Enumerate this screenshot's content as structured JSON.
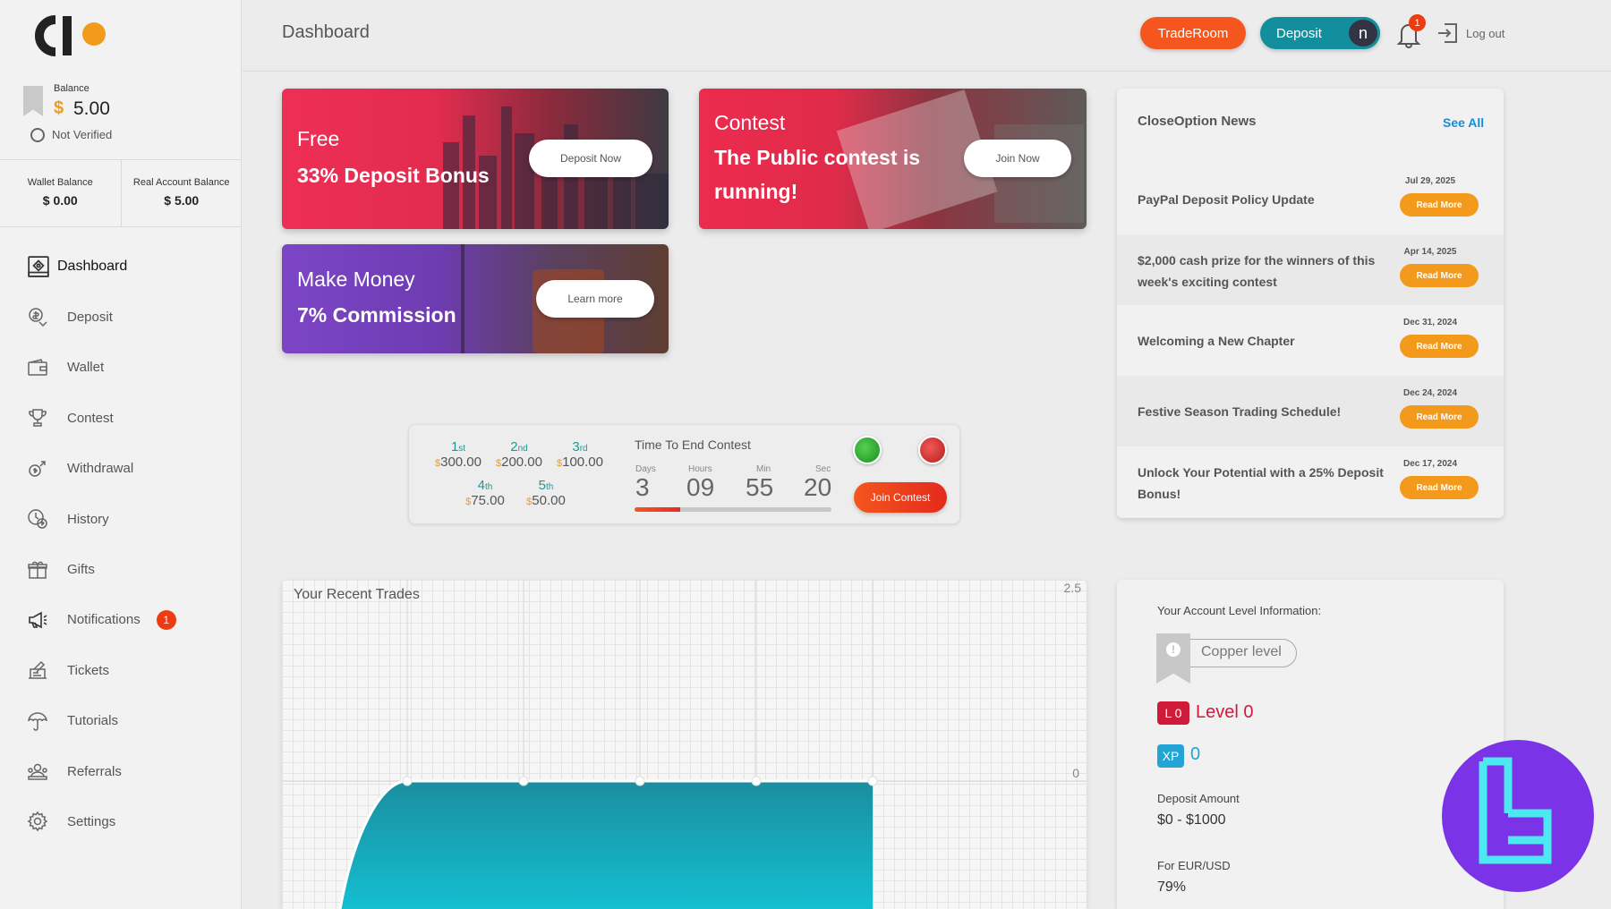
{
  "brand": {
    "accent": "#f39a1d",
    "orange": "#f4561e",
    "teal": "#128e9d"
  },
  "sidebar": {
    "balance_label": "Balance",
    "balance_currency": "$",
    "balance_value": "5.00",
    "verification": "Not Verified",
    "wallet_balance_label": "Wallet Balance",
    "wallet_balance_value": "$ 0.00",
    "real_balance_label": "Real Account Balance",
    "real_balance_value": "$ 5.00",
    "items": [
      {
        "label": "Dashboard",
        "icon": "dashboard-icon"
      },
      {
        "label": "Deposit",
        "icon": "deposit-icon"
      },
      {
        "label": "Wallet",
        "icon": "wallet-icon"
      },
      {
        "label": "Contest",
        "icon": "trophy-icon"
      },
      {
        "label": "Withdrawal",
        "icon": "withdrawal-icon"
      },
      {
        "label": "History",
        "icon": "history-icon"
      },
      {
        "label": "Gifts",
        "icon": "gift-icon"
      },
      {
        "label": "Notifications",
        "icon": "megaphone-icon",
        "badge": "1"
      },
      {
        "label": "Tickets",
        "icon": "ticket-icon"
      },
      {
        "label": "Tutorials",
        "icon": "umbrella-icon"
      },
      {
        "label": "Referrals",
        "icon": "referrals-icon"
      },
      {
        "label": "Settings",
        "icon": "gear-icon"
      }
    ]
  },
  "header": {
    "title": "Dashboard",
    "traderoom_label": "TradeRoom",
    "deposit_label": "Deposit",
    "avatar_initial": "n",
    "notification_count": "1",
    "logout_label": "Log out"
  },
  "promos": {
    "bonus": {
      "line1": "Free",
      "line2": "33% Deposit Bonus",
      "button": "Deposit Now"
    },
    "contest": {
      "line1": "Contest",
      "line2": "The Public contest is",
      "line3": "running!",
      "button": "Join Now"
    },
    "commission": {
      "line1": "Make Money",
      "line2": "7% Commission",
      "button": "Learn more"
    }
  },
  "contest_widget": {
    "prizes": [
      {
        "num": "1",
        "suffix": "st",
        "cur": "$",
        "amount": "300.00"
      },
      {
        "num": "2",
        "suffix": "nd",
        "cur": "$",
        "amount": "200.00"
      },
      {
        "num": "3",
        "suffix": "rd",
        "cur": "$",
        "amount": "100.00"
      },
      {
        "num": "4",
        "suffix": "th",
        "cur": "$",
        "amount": "75.00"
      },
      {
        "num": "5",
        "suffix": "th",
        "cur": "$",
        "amount": "50.00"
      }
    ],
    "title": "Time To End Contest",
    "days_label": "Days",
    "days": "3",
    "hours_label": "Hours",
    "hours": "09",
    "min_label": "Min",
    "min": "55",
    "sec_label": "Sec",
    "sec": "20",
    "progress_fraction": 0.23,
    "join_label": "Join Contest"
  },
  "news": {
    "title": "CloseOption News",
    "see_all": "See All",
    "read_more": "Read More",
    "items": [
      {
        "title": "PayPal Deposit Policy Update",
        "date": "Jul 29, 2025"
      },
      {
        "title": "$2,000 cash prize for the winners of this week's exciting contest",
        "date": "Apr 14, 2025"
      },
      {
        "title": "Welcoming a New Chapter",
        "date": "Dec 31, 2024"
      },
      {
        "title": "Festive Season Trading Schedule!",
        "date": "Dec 24, 2024"
      },
      {
        "title": "Unlock Your Potential with a 25% Deposit Bonus!",
        "date": "Dec 17, 2024"
      }
    ]
  },
  "recent_trades": {
    "title": "Your Recent Trades",
    "y_top_label": "2.5",
    "y_zero_label": "0"
  },
  "chart_data": {
    "type": "area",
    "title": "Your Recent Trades",
    "ylim": [
      0,
      2.5
    ],
    "y_ticks": [
      "0",
      "2.5"
    ],
    "x": [
      0,
      1,
      2,
      3,
      4,
      5
    ],
    "values": [
      -0.7,
      0,
      0,
      0,
      0,
      0
    ]
  },
  "account_level": {
    "title": "Your Account Level Information:",
    "tier": "Copper level",
    "level_chip": "L 0",
    "level_text": "Level 0",
    "xp_chip": "XP",
    "xp_value": "0",
    "deposit_label": "Deposit Amount",
    "deposit_value": "$0 - $1000",
    "pair_label": "For EUR/USD",
    "pair_value": "79%"
  }
}
